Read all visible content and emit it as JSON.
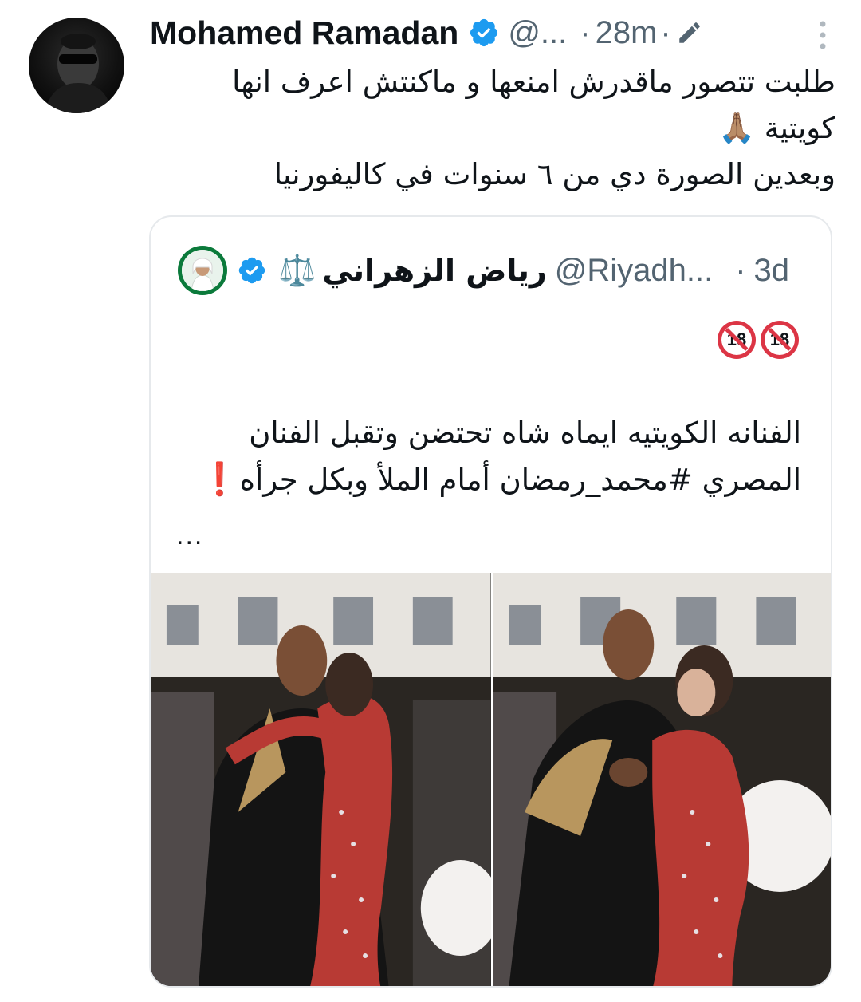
{
  "author": {
    "name": "Mohamed Ramadan",
    "handle": "@...",
    "time": "28m",
    "separator": "·"
  },
  "tweet": {
    "lines": [
      "طلبت تتصور ماقدرش امنعها و ماكنتش اعرف انها",
      "كويتية 🙏🏽",
      "وبعدين الصورة دي من ٦ سنوات في كاليفورنيا"
    ]
  },
  "quoted": {
    "name": "رياض الزهراني",
    "name_badge": "⚖️",
    "handle": "@Riyadh...",
    "time": "3d",
    "separator": "·",
    "emoji_count_label": "🔞🔞",
    "text_lines": [
      "الفنانه الكويتيه ايماه شاه تحتضن وتقبل الفنان",
      "المصري #محمد_رمضان أمام الملأ وبكل جرأه"
    ],
    "exclamation": "❗",
    "ellipsis": "..."
  },
  "icons": {
    "verified": "verified-badge-icon",
    "edit": "edit-pencil-icon",
    "more": "more-vertical-icon",
    "no_under_18": "no-under-18-icon"
  },
  "colors": {
    "text": "#0f1419",
    "secondary": "#536471",
    "verified": "#1d9bf0",
    "border": "#e6e9ec",
    "exclamation": "#e0245e"
  }
}
